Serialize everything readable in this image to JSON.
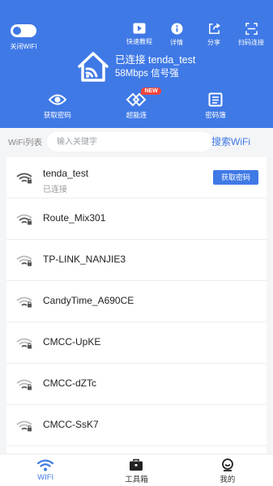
{
  "header": {
    "toggle_label": "关闭WIFI",
    "actions": [
      {
        "label": "快速教程",
        "icon": "play-icon"
      },
      {
        "label": "详情",
        "icon": "info-icon"
      },
      {
        "label": "分享",
        "icon": "share-icon"
      },
      {
        "label": "扫码连接",
        "icon": "scan-icon"
      }
    ],
    "status": {
      "line1": "已连接  tenda_test",
      "line2": "58Mbps  信号强"
    },
    "features": [
      {
        "label": "获取密码",
        "icon": "eye-icon"
      },
      {
        "label": "超能连",
        "icon": "diamond-link-icon",
        "badge": "NEW"
      },
      {
        "label": "密码簿",
        "icon": "notebook-icon"
      }
    ]
  },
  "search": {
    "label": "WiFi列表",
    "placeholder": "输入关键字",
    "button": "搜索WiFi"
  },
  "networks": [
    {
      "ssid": "tenda_test",
      "status": "已连接",
      "button": "获取密码"
    },
    {
      "ssid": "Route_Mix301"
    },
    {
      "ssid": "TP-LINK_NANJIE3"
    },
    {
      "ssid": "CandyTime_A690CE"
    },
    {
      "ssid": "CMCC-UpKE"
    },
    {
      "ssid": "CMCC-dZTc"
    },
    {
      "ssid": "CMCC-SsK7"
    }
  ],
  "bottom_nav": [
    {
      "label": "WIFI",
      "icon": "wifi-icon",
      "active": true
    },
    {
      "label": "工具箱",
      "icon": "toolbox-icon",
      "active": false
    },
    {
      "label": "我的",
      "icon": "profile-icon",
      "active": false
    }
  ],
  "colors": {
    "primary": "#3f79e6",
    "badge": "#f0453a",
    "background": "#f4f5f7"
  }
}
